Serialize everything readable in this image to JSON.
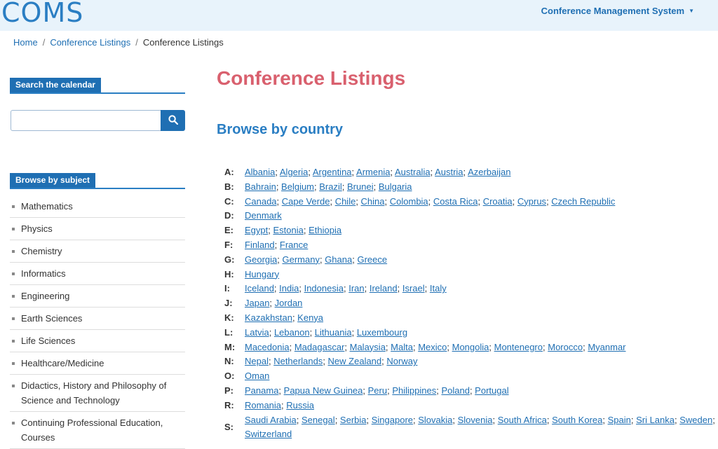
{
  "header": {
    "logo": "COMS",
    "system_menu": "Conference Management System",
    "system_menu_caret": "▼"
  },
  "breadcrumb": [
    "Home",
    "Conference Listings",
    "Conference Listings"
  ],
  "sidebar": {
    "search_heading": "Search the calendar",
    "search_placeholder": "",
    "search_icon": "search-icon",
    "subject_heading": "Browse by subject",
    "subjects": [
      "Mathematics",
      "Physics",
      "Chemistry",
      "Informatics",
      "Engineering",
      "Earth Sciences",
      "Life Sciences",
      "Healthcare/Medicine",
      "Didactics, History and Philosophy of Science and Technology",
      "Continuing Professional Education, Courses"
    ]
  },
  "main": {
    "title": "Conference Listings",
    "browse_heading": "Browse by country",
    "countries": [
      {
        "letter": "A:",
        "items": [
          "Albania",
          "Algeria",
          "Argentina",
          "Armenia",
          "Australia",
          "Austria",
          "Azerbaijan"
        ]
      },
      {
        "letter": "B:",
        "items": [
          "Bahrain",
          "Belgium",
          "Brazil",
          "Brunei",
          "Bulgaria"
        ]
      },
      {
        "letter": "C:",
        "items": [
          "Canada",
          "Cape Verde",
          "Chile",
          "China",
          "Colombia",
          "Costa Rica",
          "Croatia",
          "Cyprus",
          "Czech Republic"
        ]
      },
      {
        "letter": "D:",
        "items": [
          "Denmark"
        ]
      },
      {
        "letter": "E:",
        "items": [
          "Egypt",
          "Estonia",
          "Ethiopia"
        ]
      },
      {
        "letter": "F:",
        "items": [
          "Finland",
          "France"
        ]
      },
      {
        "letter": "G:",
        "items": [
          "Georgia",
          "Germany",
          "Ghana",
          "Greece"
        ]
      },
      {
        "letter": "H:",
        "items": [
          "Hungary"
        ]
      },
      {
        "letter": "I:",
        "items": [
          "Iceland",
          "India",
          "Indonesia",
          "Iran",
          "Ireland",
          "Israel",
          "Italy"
        ]
      },
      {
        "letter": "J:",
        "items": [
          "Japan",
          "Jordan"
        ]
      },
      {
        "letter": "K:",
        "items": [
          "Kazakhstan",
          "Kenya"
        ]
      },
      {
        "letter": "L:",
        "items": [
          "Latvia",
          "Lebanon",
          "Lithuania",
          "Luxembourg"
        ]
      },
      {
        "letter": "M:",
        "items": [
          "Macedonia",
          "Madagascar",
          "Malaysia",
          "Malta",
          "Mexico",
          "Mongolia",
          "Montenegro",
          "Morocco",
          "Myanmar"
        ]
      },
      {
        "letter": "N:",
        "items": [
          "Nepal",
          "Netherlands",
          "New Zealand",
          "Norway"
        ]
      },
      {
        "letter": "O:",
        "items": [
          "Oman"
        ]
      },
      {
        "letter": "P:",
        "items": [
          "Panama",
          "Papua New Guinea",
          "Peru",
          "Philippines",
          "Poland",
          "Portugal"
        ]
      },
      {
        "letter": "R:",
        "items": [
          "Romania",
          "Russia"
        ]
      },
      {
        "letter": "S:",
        "items": [
          "Saudi Arabia",
          "Senegal",
          "Serbia",
          "Singapore",
          "Slovakia",
          "Slovenia",
          "South Africa",
          "South Korea",
          "Spain",
          "Sri Lanka",
          "Sweden",
          "Switzerland"
        ]
      }
    ]
  },
  "colors": {
    "brand_blue": "#1f6fb3",
    "title_red": "#d9606e",
    "topbar_bg": "#e8f3fb"
  }
}
